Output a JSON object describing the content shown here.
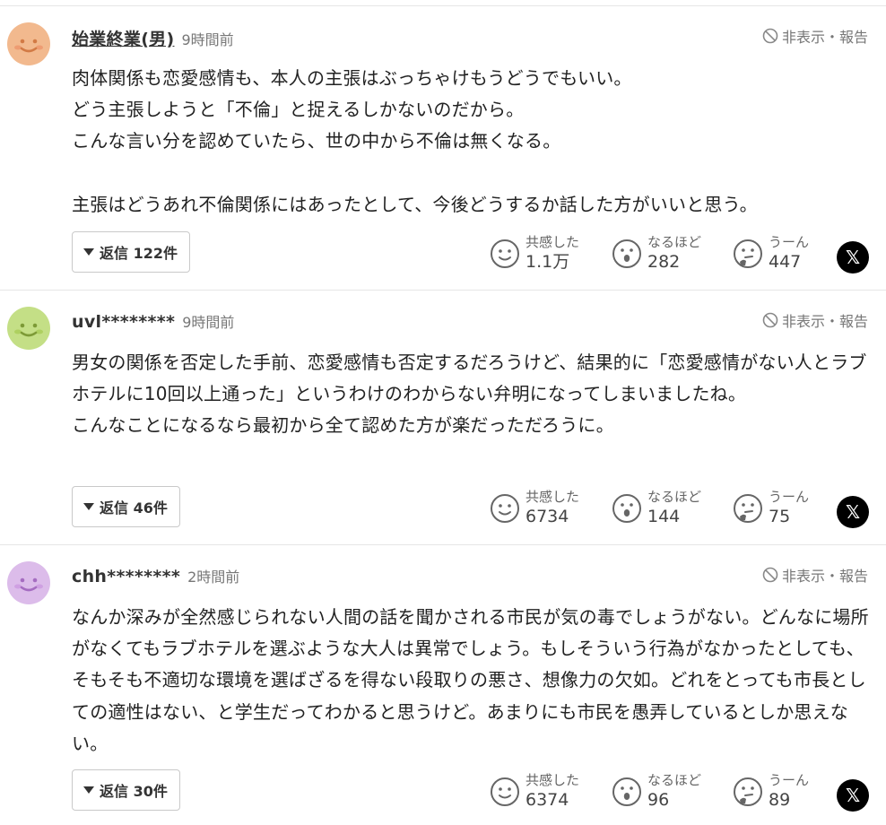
{
  "ui": {
    "report_label": "非表示・報告",
    "reactions": {
      "empathy": "共感した",
      "insight": "なるほど",
      "hmm": "うーん"
    },
    "x_label": "𝕏"
  },
  "colors": {
    "avatar_orange": "#f2b98e",
    "avatar_green": "#c4df86",
    "avatar_purple": "#dcbcea"
  },
  "comments": [
    {
      "user": "始業終業(男)",
      "time": "9時間前",
      "text": "肉体関係も恋愛感情も、本人の主張はぶっちゃけもうどうでもいい。\nどう主張しようと「不倫」と捉えるしかないのだから。\nこんな言い分を認めていたら、世の中から不倫は無くなる。\n\n主張はどうあれ不倫関係にはあったとして、今後どうするか話した方がいいと思う。",
      "reply_label": "返信 122件",
      "empathy_count": "1.1万",
      "insight_count": "282",
      "hmm_count": "447"
    },
    {
      "user": "uvl********",
      "time": "9時間前",
      "text": "男女の関係を否定した手前、恋愛感情も否定するだろうけど、結果的に「恋愛感情がない人とラブホテルに10回以上通った」というわけのわからない弁明になってしまいましたね。\nこんなことになるなら最初から全て認めた方が楽だっただろうに。",
      "reply_label": "返信 46件",
      "empathy_count": "6734",
      "insight_count": "144",
      "hmm_count": "75"
    },
    {
      "user": "chh********",
      "time": "2時間前",
      "text": "なんか深みが全然感じられない人間の話を聞かされる市民が気の毒でしょうがない。どんなに場所がなくてもラブホテルを選ぶような大人は異常でしょう。もしそういう行為がなかったとしても、そもそも不適切な環境を選ばざるを得ない段取りの悪さ、想像力の欠如。どれをとっても市長としての適性はない、と学生だってわかると思うけど。あまりにも市民を愚弄しているとしか思えない。",
      "reply_label": "返信 30件",
      "empathy_count": "6374",
      "insight_count": "96",
      "hmm_count": "89"
    }
  ]
}
